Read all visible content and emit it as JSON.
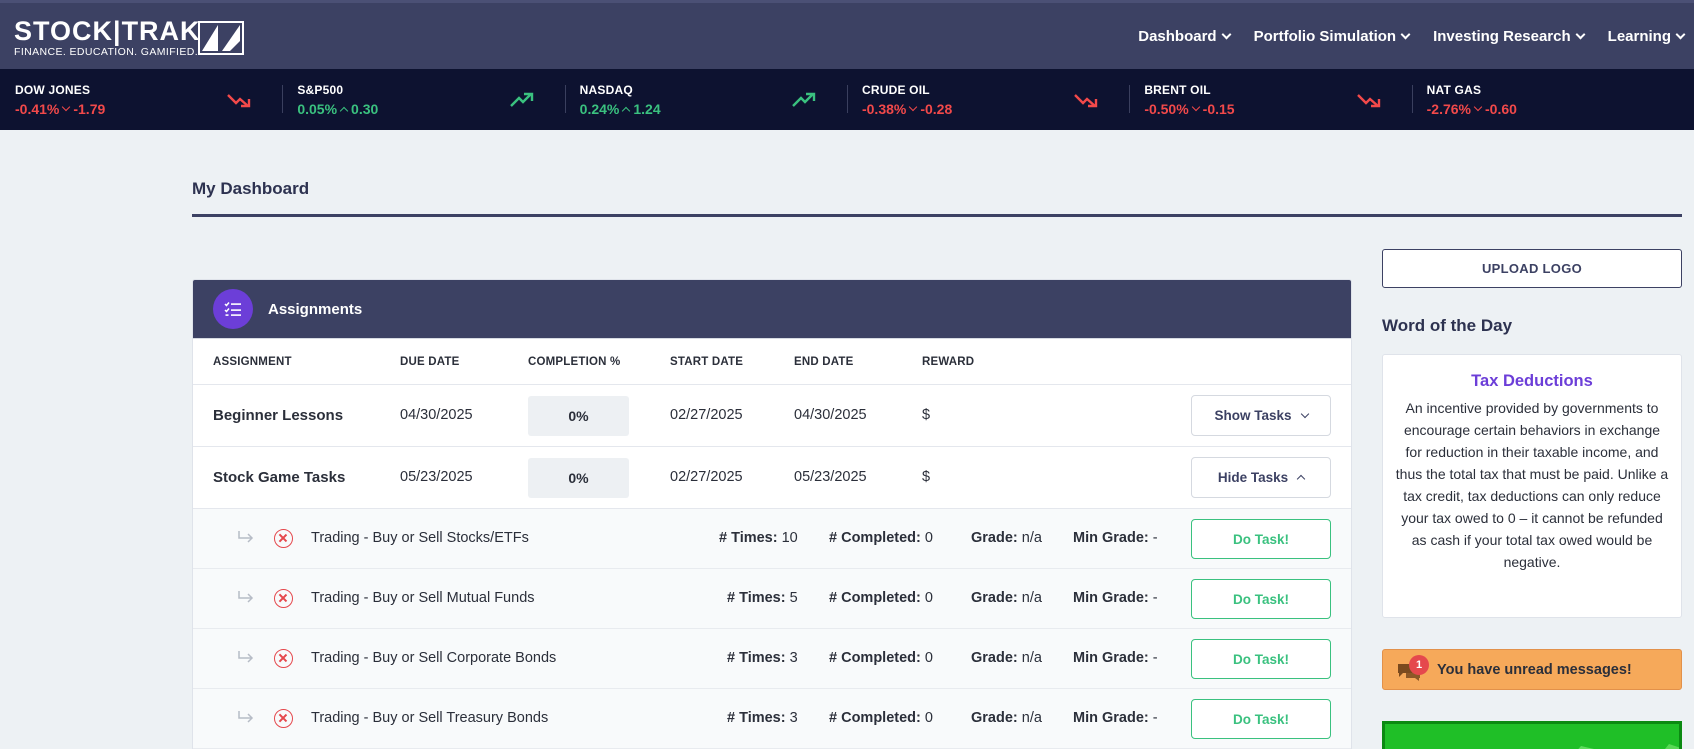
{
  "brand": {
    "name": "STOCK|TRAK",
    "tagline": "FINANCE. EDUCATION. GAMIFIED."
  },
  "nav": [
    {
      "label": "Dashboard"
    },
    {
      "label": "Portfolio Simulation"
    },
    {
      "label": "Investing Research"
    },
    {
      "label": "Learning"
    }
  ],
  "ticker": [
    {
      "name": "DOW JONES",
      "pct": "-0.41%",
      "change": "-1.79",
      "direction": "down"
    },
    {
      "name": "S&P500",
      "pct": "0.05%",
      "change": "0.30",
      "direction": "up"
    },
    {
      "name": "NASDAQ",
      "pct": "0.24%",
      "change": "1.24",
      "direction": "up"
    },
    {
      "name": "CRUDE OIL",
      "pct": "-0.38%",
      "change": "-0.28",
      "direction": "down"
    },
    {
      "name": "BRENT OIL",
      "pct": "-0.50%",
      "change": "-0.15",
      "direction": "down"
    },
    {
      "name": "NAT GAS",
      "pct": "-2.76%",
      "change": "-0.60",
      "direction": "down"
    }
  ],
  "page": {
    "title": "My Dashboard"
  },
  "assignments": {
    "title": "Assignments",
    "columns": {
      "assignment": "ASSIGNMENT",
      "due": "DUE DATE",
      "completion": "COMPLETION %",
      "start": "START DATE",
      "end": "END DATE",
      "reward": "REWARD"
    },
    "rows": [
      {
        "name": "Beginner Lessons",
        "due": "04/30/2025",
        "completion": "0%",
        "start": "02/27/2025",
        "end": "04/30/2025",
        "reward": "$",
        "toggle": "Show Tasks"
      },
      {
        "name": "Stock Game Tasks",
        "due": "05/23/2025",
        "completion": "0%",
        "start": "02/27/2025",
        "end": "05/23/2025",
        "reward": "$",
        "toggle": "Hide Tasks"
      }
    ],
    "task_labels": {
      "times": "# Times:",
      "completed": "# Completed:",
      "grade": "Grade:",
      "min_grade": "Min Grade:",
      "button": "Do Task!"
    },
    "tasks": [
      {
        "name": "Trading - Buy or Sell Stocks/ETFs",
        "times": "10",
        "completed": "0",
        "grade": "n/a",
        "min_grade": "-"
      },
      {
        "name": "Trading - Buy or Sell Mutual Funds",
        "times": "5",
        "completed": "0",
        "grade": "n/a",
        "min_grade": "-"
      },
      {
        "name": "Trading - Buy or Sell Corporate Bonds",
        "times": "3",
        "completed": "0",
        "grade": "n/a",
        "min_grade": "-"
      },
      {
        "name": "Trading - Buy or Sell Treasury Bonds",
        "times": "3",
        "completed": "0",
        "grade": "n/a",
        "min_grade": "-"
      }
    ]
  },
  "sidebar": {
    "upload_label": "UPLOAD LOGO",
    "wod_label": "Word of the Day",
    "wod_word": "Tax Deductions",
    "wod_definition": "An incentive provided by governments to encourage certain behaviors in exchange for reduction in their taxable income, and thus the total tax that must be paid. Unlike a tax credit, tax deductions can only reduce your tax owed to 0 – it cannot be refunded as cash if your total tax owed would be negative.",
    "messages_count": "1",
    "messages_text": "You have unread messages!"
  },
  "colors": {
    "header": "#3c4163",
    "ticker": "#0d1230",
    "up": "#3ac17f",
    "down": "#f2494a",
    "accent": "#6c3ed8",
    "alert": "#f6a95a"
  }
}
